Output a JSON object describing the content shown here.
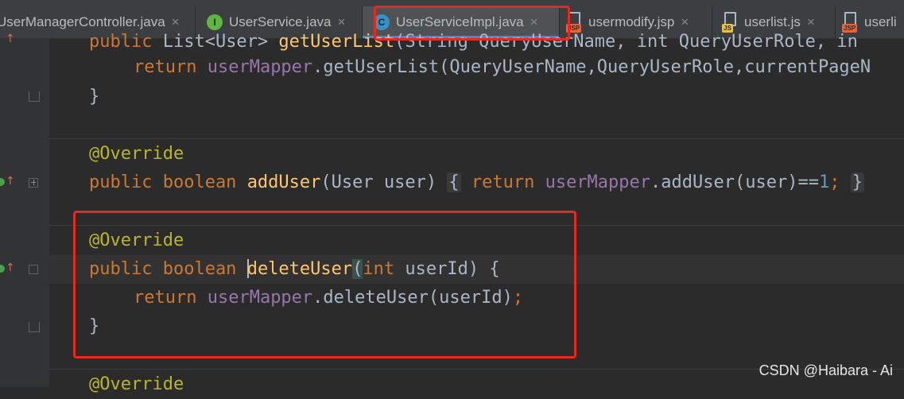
{
  "tabs": [
    {
      "label": "UserManagerController.java",
      "display": "UserManagerController.java",
      "icon": "none"
    },
    {
      "label": "UserService.java",
      "icon": "interface-icon",
      "icon_letter": "I"
    },
    {
      "label": "UserServiceImpl.java",
      "icon": "class-icon",
      "icon_letter": "C",
      "active": true
    },
    {
      "label": "usermodify.jsp",
      "icon": "jsp-file-icon",
      "icon_badge": "JSP"
    },
    {
      "label": "userlist.js",
      "icon": "js-file-icon",
      "icon_badge": "JS"
    },
    {
      "label": "userli",
      "icon": "jsp-file-icon",
      "icon_badge": "JSP"
    }
  ],
  "tab_close_glyph": "×",
  "code": {
    "line1": {
      "kw": "public ",
      "type": "List<User> ",
      "fn": "getUserList",
      "rest": "(String QueryUserName, int QueryUserRole, in"
    },
    "line2": {
      "kw": "return ",
      "field": "userMapper",
      "rest": ".getUserList(QueryUserName,QueryUserRole,currentPageN"
    },
    "line3": "}",
    "line4": "@Override",
    "line5": {
      "kw": "public boolean ",
      "fn": "addUser",
      "params": "(User user) ",
      "brace": "{",
      "ret": " return ",
      "field": "userMapper",
      "call": ".addUser(user)==",
      "num": "1",
      "semi": "; ",
      "close": "}"
    },
    "line6": "@Override",
    "line7": {
      "kw": "public boolean ",
      "fn_first": "d",
      "fn_rest": "eleteUser",
      "open": "(",
      "ptype": "int ",
      "pname": "userId) {"
    },
    "line8": {
      "kw": "return ",
      "field": "userMapper",
      "rest": ".deleteUser(userId)",
      "semi": ";"
    },
    "line9": "}",
    "line10": "@Override"
  },
  "watermark": "CSDN @Haibara - Ai",
  "colors": {
    "annotation_box": "#e8281f",
    "keyword": "#cc7832",
    "annotation": "#bbb529",
    "method": "#ffc66d",
    "field": "#9876aa"
  }
}
